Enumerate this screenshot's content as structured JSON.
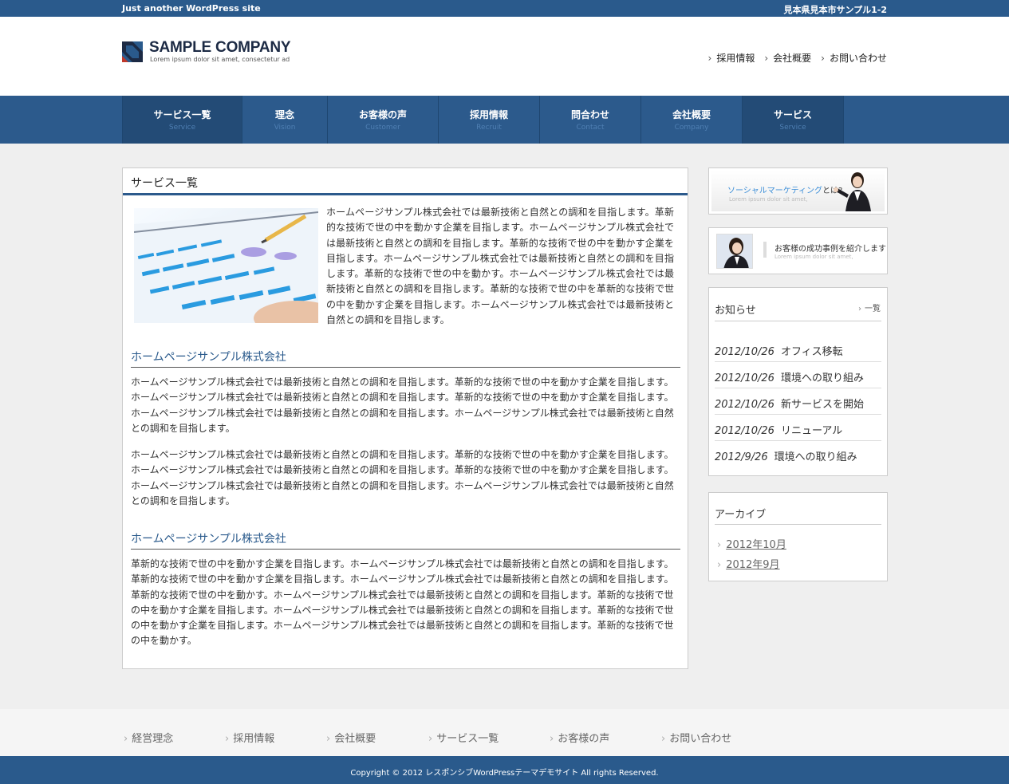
{
  "topbar": {
    "tagline": "Just another WordPress site",
    "address": "見本県見本市サンプル1-2"
  },
  "header": {
    "company_name": "SAMPLE COMPANY",
    "company_sub": "Lorem ipsum dolor sit amet, consectetur ad",
    "links": [
      "採用情報",
      "会社概要",
      "お問い合わせ"
    ]
  },
  "nav": [
    {
      "jp": "サービス一覧",
      "en": "Service"
    },
    {
      "jp": "理念",
      "en": "Vision"
    },
    {
      "jp": "お客様の声",
      "en": "Customer"
    },
    {
      "jp": "採用情報",
      "en": "Recruit"
    },
    {
      "jp": "問合わせ",
      "en": "Contact"
    },
    {
      "jp": "会社概要",
      "en": "Company"
    },
    {
      "jp": "サービス",
      "en": "Service"
    }
  ],
  "main": {
    "title": "サービス一覧",
    "intro": "ホームページサンプル株式会社では最新技術と自然との調和を目指します。革新的な技術で世の中を動かす企業を目指します。ホームページサンプル株式会社では最新技術と自然との調和を目指します。革新的な技術で世の中を動かす企業を目指します。ホームページサンプル株式会社では最新技術と自然との調和を目指します。革新的な技術で世の中を動かす。ホームページサンプル株式会社では最新技術と自然との調和を目指します。革新的な技術で世の中を革新的な技術で世の中を動かす企業を目指します。ホームページサンプル株式会社では最新技術と自然との調和を目指します。",
    "heading1": "ホームページサンプル株式会社",
    "para1": "ホームページサンプル株式会社では最新技術と自然との調和を目指します。革新的な技術で世の中を動かす企業を目指します。ホームページサンプル株式会社では最新技術と自然との調和を目指します。革新的な技術で世の中を動かす企業を目指します。ホームページサンプル株式会社では最新技術と自然との調和を目指します。ホームページサンプル株式会社では最新技術と自然との調和を目指します。",
    "para2": "ホームページサンプル株式会社では最新技術と自然との調和を目指します。革新的な技術で世の中を動かす企業を目指します。ホームページサンプル株式会社では最新技術と自然との調和を目指します。革新的な技術で世の中を動かす企業を目指します。ホームページサンプル株式会社では最新技術と自然との調和を目指します。ホームページサンプル株式会社では最新技術と自然との調和を目指します。",
    "heading2": "ホームページサンプル株式会社",
    "para3": "革新的な技術で世の中を動かす企業を目指します。ホームページサンプル株式会社では最新技術と自然との調和を目指します。革新的な技術で世の中を動かす企業を目指します。ホームページサンプル株式会社では最新技術と自然との調和を目指します。革新的な技術で世の中を動かす。ホームページサンプル株式会社では最新技術と自然との調和を目指します。革新的な技術で世の中を動かす企業を目指します。ホームページサンプル株式会社では最新技術と自然との調和を目指します。革新的な技術で世の中を動かす企業を目指します。ホームページサンプル株式会社では最新技術と自然との調和を目指します。革新的な技術で世の中を動かす。"
  },
  "sidebar": {
    "banner1": {
      "title_highlight": "ソーシャルマーケティング",
      "title_rest": "とは?",
      "sub": "Lorem ipsum dolor sit amet,"
    },
    "banner2": {
      "title": "お客様の成功事例を紹介します",
      "sub": "Lorem ipsum dolor sit amet,"
    },
    "news": {
      "title": "お知らせ",
      "more": "一覧",
      "items": [
        {
          "date": "2012/10/26",
          "text": "オフィス移転"
        },
        {
          "date": "2012/10/26",
          "text": "環境への取り組み"
        },
        {
          "date": "2012/10/26",
          "text": "新サービスを開始"
        },
        {
          "date": "2012/10/26",
          "text": "リニューアル"
        },
        {
          "date": "2012/9/26",
          "text": "環境への取り組み"
        }
      ]
    },
    "archive": {
      "title": "アーカイブ",
      "items": [
        "2012年10月",
        "2012年9月"
      ]
    }
  },
  "footer": {
    "links": [
      "経営理念",
      "採用情報",
      "会社概要",
      "サービス一覧",
      "お客様の声",
      "お問い合わせ"
    ],
    "copyright": "Copyright © 2012 レスポンシブWordPressテーマデモサイト All rights Reserved."
  },
  "colors": {
    "brand": "#2a5a8c",
    "nav_active": "#234b76",
    "accent_link": "#3b8ed8"
  }
}
